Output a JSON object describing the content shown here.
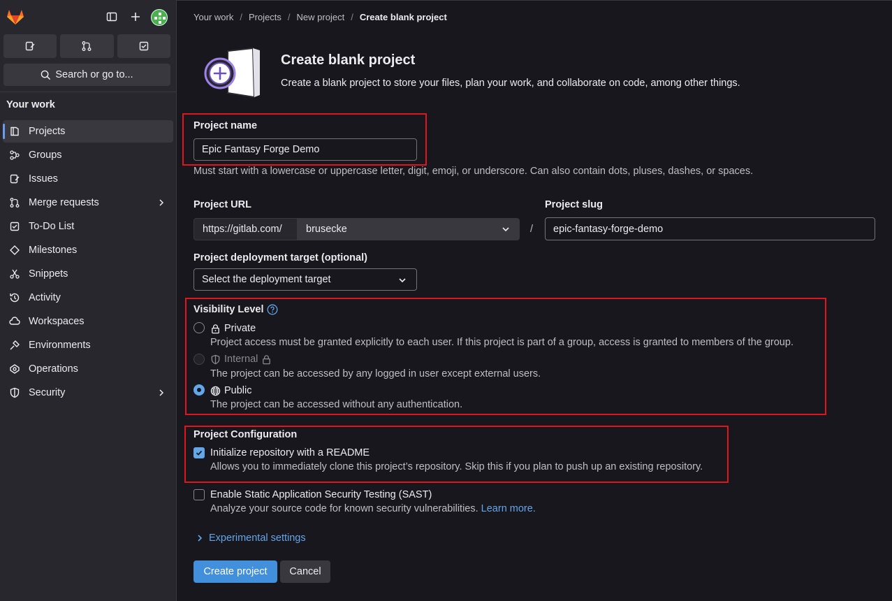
{
  "sidebar": {
    "section_title": "Your work",
    "search_label": "Search or go to...",
    "items": [
      {
        "label": "Projects",
        "icon": "project-icon"
      },
      {
        "label": "Groups",
        "icon": "group-icon"
      },
      {
        "label": "Issues",
        "icon": "issues-icon"
      },
      {
        "label": "Merge requests",
        "icon": "merge-request-icon"
      },
      {
        "label": "To-Do List",
        "icon": "todo-icon"
      },
      {
        "label": "Milestones",
        "icon": "milestone-icon"
      },
      {
        "label": "Snippets",
        "icon": "snippet-icon"
      },
      {
        "label": "Activity",
        "icon": "history-icon"
      },
      {
        "label": "Workspaces",
        "icon": "workspace-icon"
      },
      {
        "label": "Environments",
        "icon": "environment-icon"
      },
      {
        "label": "Operations",
        "icon": "operations-icon"
      },
      {
        "label": "Security",
        "icon": "shield-icon"
      }
    ]
  },
  "breadcrumb": [
    "Your work",
    "Projects",
    "New project",
    "Create blank project"
  ],
  "header": {
    "title": "Create blank project",
    "description": "Create a blank project to store your files, plan your work, and collaborate on code, among other things."
  },
  "form": {
    "project_name": {
      "label": "Project name",
      "value": "Epic Fantasy Forge Demo",
      "help": "Must start with a lowercase or uppercase letter, digit, emoji, or underscore. Can also contain dots, pluses, dashes, or spaces."
    },
    "project_url": {
      "label": "Project URL",
      "prefix": "https://gitlab.com/",
      "namespace": "brusecke",
      "separator": "/"
    },
    "project_slug": {
      "label": "Project slug",
      "value": "epic-fantasy-forge-demo"
    },
    "deployment_target": {
      "label": "Project deployment target (optional)",
      "value": "Select the deployment target"
    },
    "visibility": {
      "label": "Visibility Level",
      "selected": "Public",
      "options": [
        {
          "title": "Private",
          "desc": "Project access must be granted explicitly to each user. If this project is part of a group, access is granted to members of the group."
        },
        {
          "title": "Internal",
          "desc": "The project can be accessed by any logged in user except external users."
        },
        {
          "title": "Public",
          "desc": "The project can be accessed without any authentication."
        }
      ]
    },
    "configuration": {
      "label": "Project Configuration",
      "readme": {
        "title": "Initialize repository with a README",
        "desc": "Allows you to immediately clone this project’s repository. Skip this if you plan to push up an existing repository.",
        "checked": true
      },
      "sast": {
        "title": "Enable Static Application Security Testing (SAST)",
        "desc": "Analyze your source code for known security vulnerabilities.",
        "link": "Learn more.",
        "checked": false
      }
    },
    "experimental": "Experimental settings",
    "create_button": "Create project",
    "cancel_button": "Cancel"
  },
  "colors": {
    "accent": "#428fdc",
    "link": "#63a6e9",
    "highlight": "#e0151d"
  }
}
